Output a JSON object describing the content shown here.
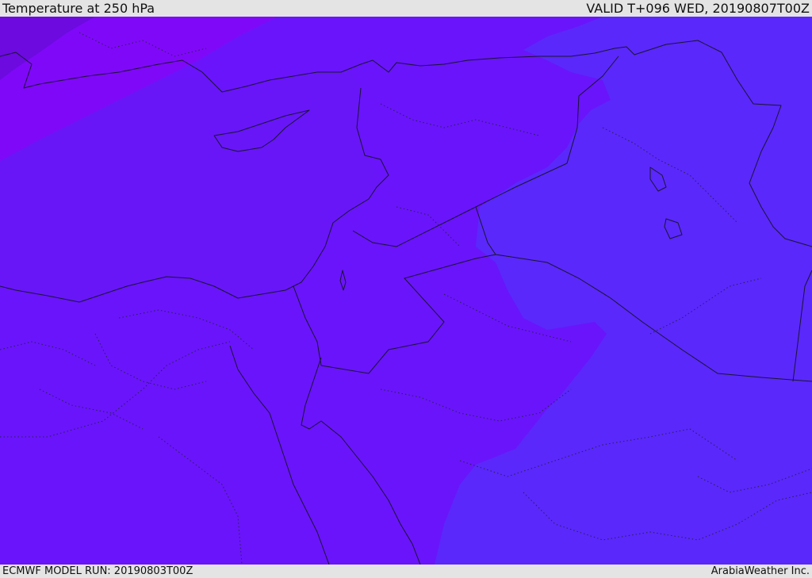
{
  "header": {
    "title": "Temperature at 250 hPa",
    "valid": "VALID T+096 WED, 20190807T00Z"
  },
  "footer": {
    "model_run": "ECMWF MODEL RUN: 20190803T00Z",
    "credit": "ArabiaWeather Inc."
  },
  "colors": {
    "base": "#6a14fb",
    "warm_zone": "#5a28fb",
    "cold_zone": "#8008f8",
    "cold_core": "#6c0ae0",
    "water_inner": "#6816f8",
    "line": "#1a1530"
  }
}
